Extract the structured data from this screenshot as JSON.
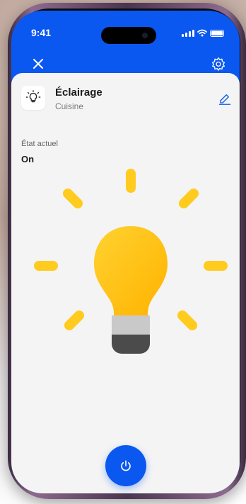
{
  "status_bar": {
    "time": "9:41"
  },
  "device": {
    "name": "Éclairage",
    "room": "Cuisine",
    "state_label": "État actuel",
    "state_value": "On"
  },
  "colors": {
    "accent": "#0A58F0",
    "bulb": "#FFC91A",
    "background": "#F4F4F4"
  },
  "icons": {
    "close": "close-icon",
    "settings": "gear-icon",
    "device": "lightbulb-icon",
    "edit": "pencil-icon",
    "power": "power-icon"
  }
}
